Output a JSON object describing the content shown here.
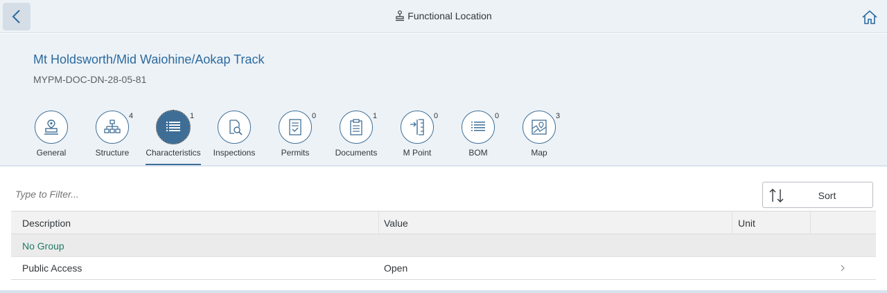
{
  "shell": {
    "title": "Functional Location",
    "icons": {
      "back": "back-arrow-icon",
      "title": "functional-location-icon",
      "home": "home-icon"
    }
  },
  "object": {
    "title": "Mt Holdsworth/Mid Waiohine/Aokap Track",
    "subtitle": "MYPM-DOC-DN-28-05-81"
  },
  "tabs": [
    {
      "label": "General",
      "count": "",
      "icon": "location-stamp-icon",
      "selected": false
    },
    {
      "label": "Structure",
      "count": "4",
      "icon": "hierarchy-icon",
      "selected": false
    },
    {
      "label": "Characteristics",
      "count": "1",
      "icon": "list-icon",
      "selected": true
    },
    {
      "label": "Inspections",
      "count": "",
      "icon": "inspection-icon",
      "selected": false
    },
    {
      "label": "Permits",
      "count": "0",
      "icon": "permit-icon",
      "selected": false
    },
    {
      "label": "Documents",
      "count": "1",
      "icon": "clipboard-icon",
      "selected": false
    },
    {
      "label": "M Point",
      "count": "0",
      "icon": "measuring-point-icon",
      "selected": false
    },
    {
      "label": "BOM",
      "count": "0",
      "icon": "bom-list-icon",
      "selected": false
    },
    {
      "label": "Map",
      "count": "3",
      "icon": "map-icon",
      "selected": false
    }
  ],
  "filter": {
    "placeholder": "Type to Filter..."
  },
  "sort": {
    "label": "Sort",
    "icon": "sort-icon"
  },
  "table": {
    "columns": [
      "Description",
      "Value",
      "Unit"
    ],
    "group": "No Group",
    "rows": [
      {
        "description": "Public Access",
        "value": "Open",
        "unit": ""
      }
    ]
  },
  "colors": {
    "accent": "#3e6e96",
    "title": "#2b6a9e",
    "group": "#1f7a63",
    "header_bg": "#edf2f7"
  }
}
